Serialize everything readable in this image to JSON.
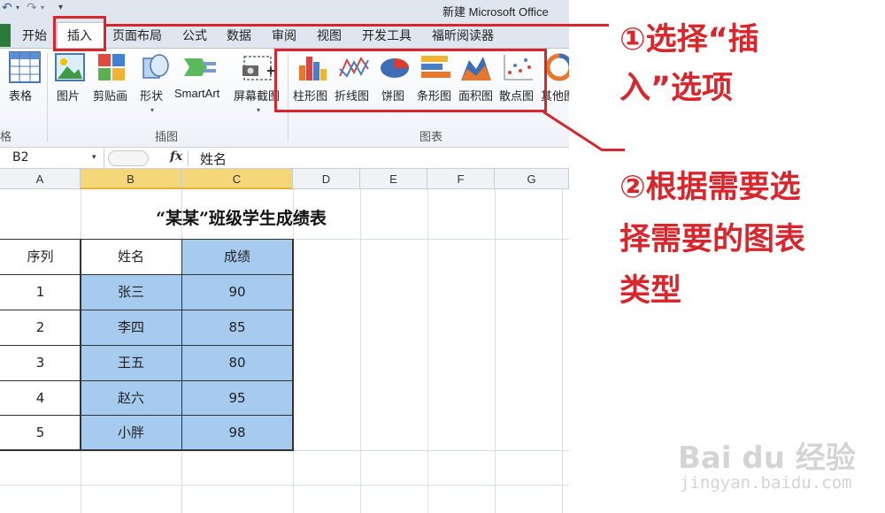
{
  "window": {
    "title": "新建 Microsoft Office"
  },
  "quick_access": {
    "undo": "↶",
    "redo": "↷",
    "dropdown": "▾",
    "customize": "▾"
  },
  "tabs": [
    "开始",
    "插入",
    "页面布局",
    "公式",
    "数据",
    "审阅",
    "视图",
    "开发工具",
    "福昕阅读器"
  ],
  "active_tab": "插入",
  "ribbon": {
    "buttons": {
      "table": "表格",
      "picture": "图片",
      "clipart": "剪贴画",
      "shapes": "形状",
      "smartart": "SmartArt",
      "screenshot": "屏幕截图",
      "column": "柱形图",
      "line": "折线图",
      "pie": "饼图",
      "bar": "条形图",
      "area": "面积图",
      "scatter": "散点图",
      "other": "其他图"
    },
    "groups": {
      "tables": "格",
      "illustrations": "插图",
      "charts": "图表"
    }
  },
  "formula_bar": {
    "name_box": "B2",
    "fx": "fx",
    "value": "姓名"
  },
  "columns": [
    "A",
    "B",
    "C",
    "D",
    "E",
    "F",
    "G"
  ],
  "selected_columns": [
    "B",
    "C"
  ],
  "sheet": {
    "title": "“某某”班级学生成绩表",
    "headers": [
      "序列",
      "姓名",
      "成绩"
    ],
    "rows": [
      [
        "1",
        "张三",
        "90"
      ],
      [
        "2",
        "李四",
        "85"
      ],
      [
        "3",
        "王五",
        "80"
      ],
      [
        "4",
        "赵六",
        "95"
      ],
      [
        "5",
        "小胖",
        "98"
      ]
    ]
  },
  "annotations": {
    "step1_line1": "①选择“插",
    "step1_line2": "入”选项",
    "step2_line1": "②根据需要选",
    "step2_line2": "择需要的图表",
    "step2_line3": "类型"
  },
  "watermark": {
    "logo": "Bai du 经验",
    "url": "jingyan.baidu.com"
  },
  "colors": {
    "annotation_red": "#d8262c",
    "selection_blue": "#a6cbee",
    "selected_header": "#f5d77a"
  }
}
